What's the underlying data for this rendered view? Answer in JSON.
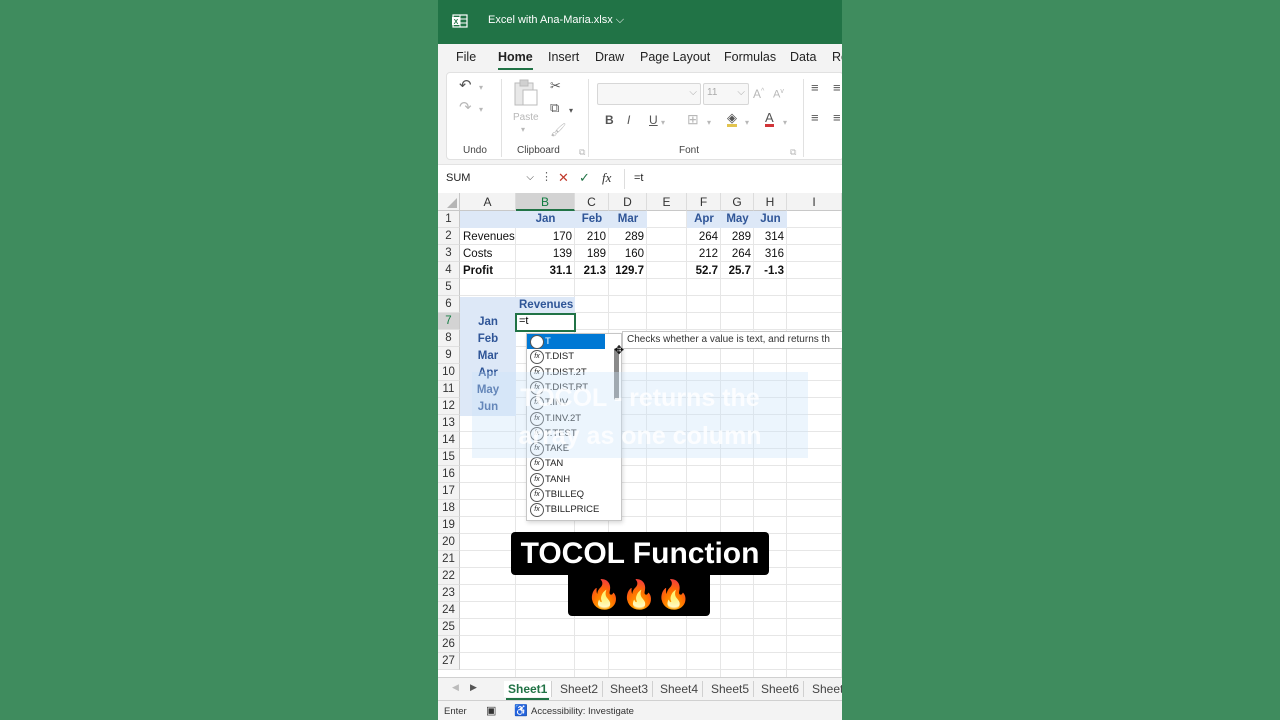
{
  "window": {
    "title": "Excel with Ana-Maria.xlsx"
  },
  "ribbon_tabs": [
    "File",
    "Home",
    "Insert",
    "Draw",
    "Page Layout",
    "Formulas",
    "Data",
    "Re"
  ],
  "ribbon": {
    "undo_label": "Undo",
    "paste_label": "Paste",
    "clipboard_label": "Clipboard",
    "font_label": "Font",
    "font_size": "11",
    "bold": "B",
    "italic": "I",
    "underline": "U"
  },
  "formula_bar": {
    "name_box": "SUM",
    "fx": "fx",
    "formula": "=t"
  },
  "columns": [
    "A",
    "B",
    "C",
    "D",
    "E",
    "F",
    "G",
    "H",
    "I"
  ],
  "rows": [
    "1",
    "2",
    "3",
    "4",
    "5",
    "6",
    "7",
    "8",
    "9",
    "10",
    "11",
    "12",
    "13",
    "14",
    "15",
    "16",
    "17",
    "18",
    "19",
    "20",
    "21",
    "22",
    "23",
    "24",
    "25",
    "26",
    "27"
  ],
  "table": {
    "headers_left": [
      "Jan",
      "Feb",
      "Mar"
    ],
    "headers_right": [
      "Apr",
      "May",
      "Jun"
    ],
    "revenues": {
      "label": "Revenues",
      "values": [
        "170",
        "210",
        "289",
        "264",
        "289",
        "314"
      ]
    },
    "costs": {
      "label": "Costs",
      "values": [
        "139",
        "189",
        "160",
        "212",
        "264",
        "316"
      ]
    },
    "profit": {
      "label": "Profit",
      "values": [
        "31.1",
        "21.3",
        "129.7",
        "52.7",
        "25.7",
        "-1.3"
      ]
    }
  },
  "block2": {
    "header": "Revenues",
    "months": [
      "Jan",
      "Feb",
      "Mar",
      "Apr",
      "May",
      "Jun"
    ],
    "active_input": "=t"
  },
  "autocomplete": {
    "items": [
      "T",
      "T.DIST",
      "T.DIST.2T",
      "T.DIST.RT",
      "T.INV",
      "T.INV.2T",
      "T.TEST",
      "TAKE",
      "TAN",
      "TANH",
      "TBILLEQ",
      "TBILLPRICE"
    ],
    "selected": 0,
    "tooltip": "Checks whether a value is text, and returns th"
  },
  "sheets": [
    "Sheet1",
    "Sheet2",
    "Sheet3",
    "Sheet4",
    "Sheet5",
    "Sheet6",
    "Sheet"
  ],
  "status": {
    "mode": "Enter",
    "accessibility": "Accessibility: Investigate"
  },
  "overlay": {
    "subtitle_lines": [
      "TOCOL - returns the",
      "array as one column"
    ],
    "caption": "TOCOL Function",
    "emoji": "🔥🔥🔥"
  },
  "colors": {
    "excel_green": "#217346",
    "background": "#3f8c5e",
    "header_fill": "#dde8f7",
    "header_text": "#2f5597"
  }
}
